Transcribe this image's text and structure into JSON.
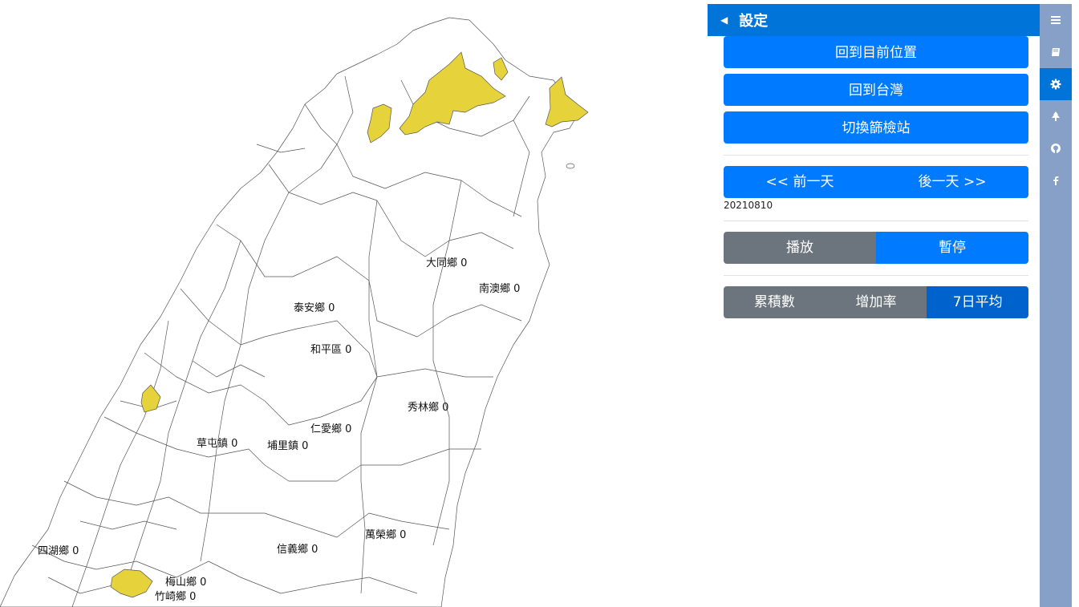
{
  "map": {
    "labels": [
      {
        "text": "大同鄉 0"
      },
      {
        "text": "南澳鄉 0"
      },
      {
        "text": "泰安鄉 0"
      },
      {
        "text": "和平區 0"
      },
      {
        "text": "秀林鄉 0"
      },
      {
        "text": "仁愛鄉 0"
      },
      {
        "text": "草屯鎮 0"
      },
      {
        "text": "埔里鎮 0"
      },
      {
        "text": "萬榮鄉 0"
      },
      {
        "text": "信義鄉 0"
      },
      {
        "text": "四湖鄉 0"
      },
      {
        "text": "梅山鄉 0"
      },
      {
        "text": "竹崎鄉 0"
      }
    ],
    "highlight_color": "#e6d33c",
    "border_color": "#555555"
  },
  "panel": {
    "title": "設定",
    "buttons": {
      "locate": "回到目前位置",
      "taiwan": "回到台灣",
      "switch_station": "切換篩檢站"
    },
    "day_nav": {
      "prev": "<< 前一天",
      "next": "後一天 >>"
    },
    "date": "20210810",
    "playback": {
      "play": "播放",
      "pause": "暫停"
    },
    "mode": {
      "cumulative": "累積數",
      "growth": "增加率",
      "avg7": "7日平均",
      "selected": "7日平均"
    }
  },
  "rail": {
    "tabs": [
      {
        "icon": "menu-icon"
      },
      {
        "icon": "book-icon"
      },
      {
        "icon": "gear-icon",
        "active": true
      },
      {
        "icon": "tree-icon"
      },
      {
        "icon": "github-icon"
      },
      {
        "icon": "facebook-icon"
      }
    ]
  }
}
